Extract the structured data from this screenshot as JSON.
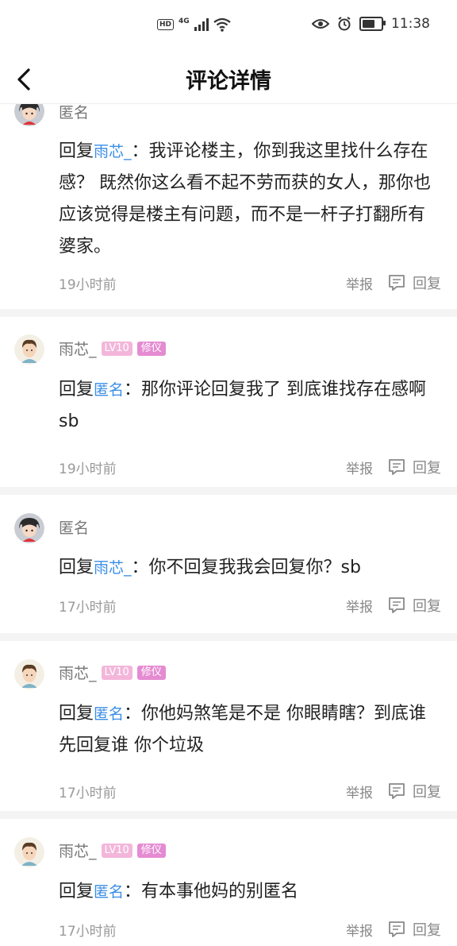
{
  "status_bar": {
    "hd": "HD",
    "network": "4G",
    "time": "11:38",
    "battery_level": 0.7
  },
  "header": {
    "title": "评论详情"
  },
  "comments": [
    {
      "author": "匿名",
      "avatar": "anon-avatar",
      "reply_prefix": "回复",
      "reply_to": "雨芯_",
      "separator": "：",
      "text": "我评论楼主，你到我这里找什么存在感？ 既然你这么看不起不劳而获的女人，那你也应该觉得是楼主有问题，而不是一杆子打翻所有婆家。",
      "time": "19小时前",
      "report": "举报",
      "reply": "回复"
    },
    {
      "author": "雨芯_",
      "avatar": "boy-avatar",
      "level": "LV10",
      "badge": "修仪",
      "reply_prefix": "回复",
      "reply_to": "匿名",
      "separator": "：",
      "text": "那你评论回复我了 到底谁找存在感啊 sb",
      "time": "19小时前",
      "report": "举报",
      "reply": "回复"
    },
    {
      "author": "匿名",
      "avatar": "anon-avatar",
      "reply_prefix": "回复",
      "reply_to": "雨芯_",
      "separator": "：",
      "text": "你不回复我我会回复你？sb",
      "time": "17小时前",
      "report": "举报",
      "reply": "回复"
    },
    {
      "author": "雨芯_",
      "avatar": "boy-avatar",
      "level": "LV10",
      "badge": "修仪",
      "reply_prefix": "回复",
      "reply_to": "匿名",
      "separator": "：",
      "text": "你他妈煞笔是不是 你眼睛瞎？到底谁先回复谁 你个垃圾",
      "time": "17小时前",
      "report": "举报",
      "reply": "回复"
    },
    {
      "author": "雨芯_",
      "avatar": "boy-avatar",
      "level": "LV10",
      "badge": "修仪",
      "reply_prefix": "回复",
      "reply_to": "匿名",
      "separator": "：",
      "text": "有本事他妈的别匿名",
      "time": "17小时前",
      "report": "举报",
      "reply": "回复"
    }
  ]
}
